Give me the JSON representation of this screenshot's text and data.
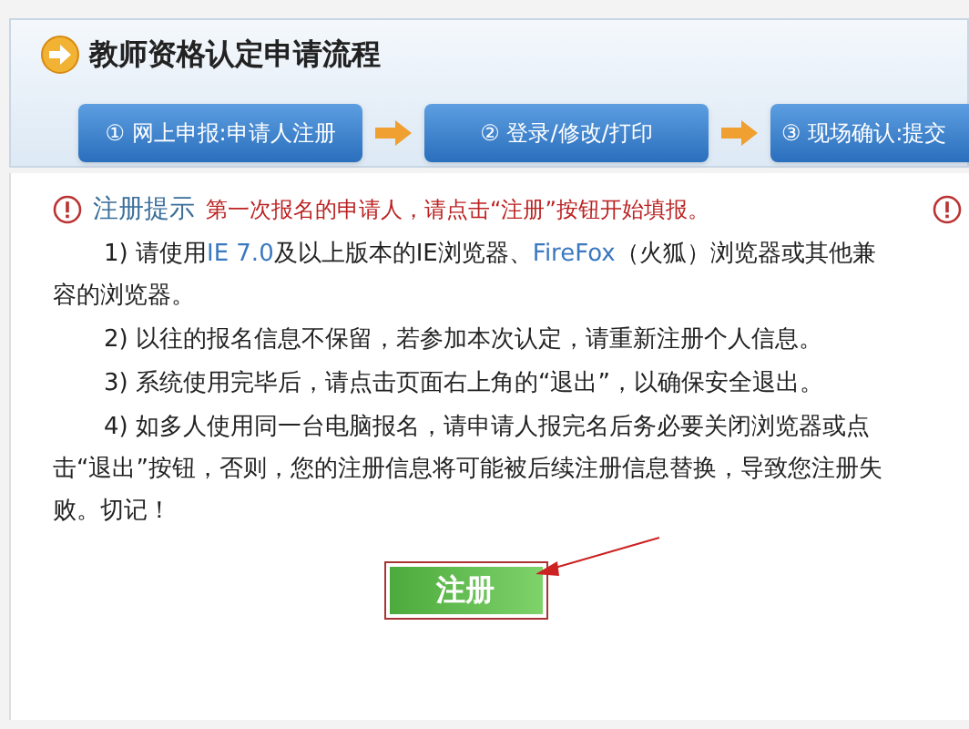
{
  "header": {
    "title": "教师资格认定申请流程"
  },
  "steps": [
    {
      "label": "① 网上申报:申请人注册"
    },
    {
      "label": "② 登录/修改/打印"
    },
    {
      "label": "③ 现场确认:提交"
    }
  ],
  "notice": {
    "title": "注册提示",
    "message": "第一次报名的申请人，请点击“注册”按钮开始填报。"
  },
  "paragraphs": [
    [
      {
        "text": "1) 请使用",
        "highlight": false
      },
      {
        "text": "IE 7.0",
        "highlight": true
      },
      {
        "text": "及以上版本的IE浏览器、",
        "highlight": false
      },
      {
        "text": "FireFox",
        "highlight": true
      },
      {
        "text": "（火狐）浏览器或其他兼容的浏览器。",
        "highlight": false
      }
    ],
    [
      {
        "text": "2) 以往的报名信息不保留，若参加本次认定，请重新注册个人信息。",
        "highlight": false
      }
    ],
    [
      {
        "text": "3) 系统使用完毕后，请点击页面右上角的“退出”，以确保安全退出。",
        "highlight": false
      }
    ],
    [
      {
        "text": "4) 如多人使用同一台电脑报名，请申请人报完名后务必要关闭浏览器或点击“退出”按钮，否则，您的注册信息将可能被后续注册信息替换，导致您注册失败。切记！",
        "highlight": false
      }
    ]
  ],
  "register_button": {
    "label": "注册"
  }
}
